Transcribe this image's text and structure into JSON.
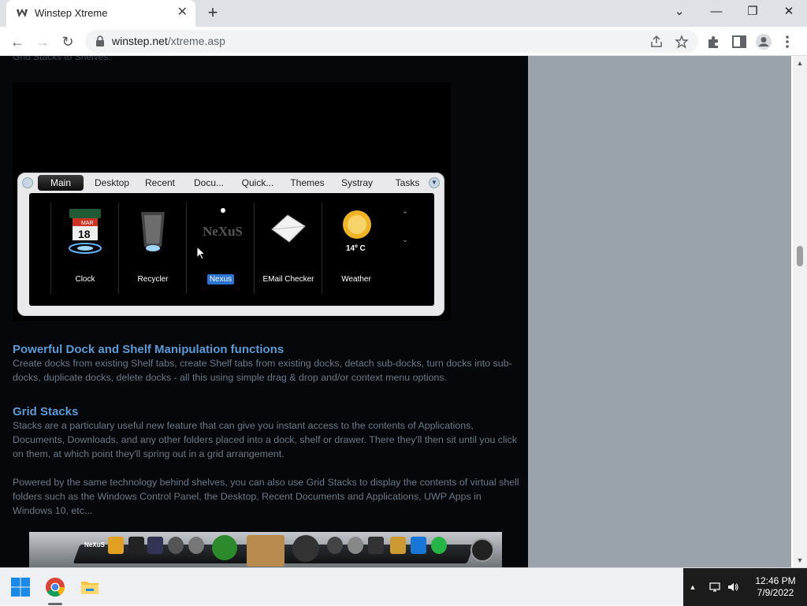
{
  "browser": {
    "tab_title": "Winstep Xtreme",
    "tab_close": "✕",
    "new_tab": "+",
    "url_host": "winstep.net",
    "url_path": "/xtreme.asp",
    "window_controls": {
      "minimize": "—",
      "restore": "❐",
      "close": "✕",
      "tabsearch": "⌄"
    },
    "nav": {
      "back": "←",
      "forward": "→",
      "reload": "↻"
    }
  },
  "page": {
    "cut_text": "Grid Stacks to Shelves.",
    "shelf": {
      "tabs": [
        "Main",
        "Desktop",
        "Recent",
        "Docu...",
        "Quick...",
        "Themes",
        "Systray",
        "Tasks"
      ],
      "active_tab": "Main",
      "items": [
        {
          "label": "Clock",
          "icon": "clock-icon",
          "calendar_month": "MAR",
          "calendar_day": "18"
        },
        {
          "label": "Recycler",
          "icon": "recycler-icon"
        },
        {
          "label": "Nexus",
          "icon": "nexus-icon",
          "logo_text": "NeXuS"
        },
        {
          "label": "EMail Checker",
          "icon": "email-checker-icon"
        },
        {
          "label": "Weather",
          "icon": "weather-icon",
          "temp": "14º C"
        }
      ],
      "scroll_up": "⌃",
      "scroll_down": "⌄"
    },
    "section1": {
      "heading": "Powerful Dock and Shelf Manipulation functions",
      "body": "Create docks from existing Shelf tabs, create Shelf tabs from existing docks, detach sub-docks, turn docks into sub-docks, duplicate docks, delete docks - all this using simple drag & drop and/or context menu options."
    },
    "section2": {
      "heading": "Grid Stacks",
      "body1": "Stacks are a particulary useful new feature that can give you instant access to the contents of Applications, Documents, Downloads, and any other folders placed into a dock, shelf or drawer. There they'll then sit until you click on them, at which point they'll spring out in a grid arrangement.",
      "body2": "Powered by the same technology behind shelves, you can also use Grid Stacks to display the contents of virtual shell folders such as the Windows Control Panel, the Desktop, Recent Documents and Applications, UWP Apps in Windows 10, etc..."
    },
    "dock_logo_text": "NeXuS"
  },
  "taskbar": {
    "apps": [
      "start-icon",
      "chrome-icon",
      "file-explorer-icon"
    ],
    "time": "12:46 PM",
    "date": "7/9/2022",
    "tray_chevron": "▲"
  },
  "colors": {
    "page_bg": "#05070a",
    "sidebar_bg": "#9aa3ac",
    "heading": "#5b9bd5",
    "body_text": "#6b7a8a",
    "selected_label": "#2a74d6"
  }
}
